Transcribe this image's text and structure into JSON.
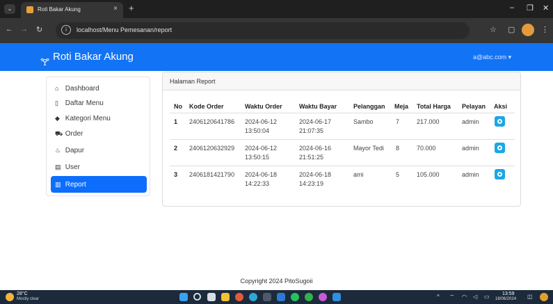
{
  "browser": {
    "tab_title": "Roti Bakar Akung",
    "tab_close": "×",
    "new_tab": "+",
    "url": "localhost/Menu Pemesanan/report",
    "win_min": "–",
    "win_max": "❐",
    "win_close": "✕"
  },
  "navbar": {
    "brand": "Roti Bakar Akung",
    "brand_icon": "🝖",
    "user_email": "a@abc.com ▾"
  },
  "sidebar": {
    "items": [
      {
        "label": "Dashboard",
        "icon": "home-icon",
        "glyph": "⌂"
      },
      {
        "label": "Daftar Menu",
        "icon": "book-icon",
        "glyph": "▯"
      },
      {
        "label": "Kategori Menu",
        "icon": "tag-icon",
        "glyph": "◆"
      },
      {
        "label": "Order",
        "icon": "cart-icon",
        "glyph": "⛟"
      },
      {
        "label": "Dapur",
        "icon": "fire-icon",
        "glyph": "♨"
      },
      {
        "label": "User",
        "icon": "user-card-icon",
        "glyph": "▤"
      },
      {
        "label": "Report",
        "icon": "chart-icon",
        "glyph": "▥"
      }
    ],
    "active": "Report"
  },
  "report": {
    "title": "Halaman Report",
    "columns": [
      "No",
      "Kode Order",
      "Waktu Order",
      "Waktu Bayar",
      "Pelanggan",
      "Meja",
      "Total Harga",
      "Pelayan",
      "Aksi"
    ],
    "rows": [
      {
        "no": "1",
        "kode": "2406120641786",
        "waktu_order_date": "2024-06-12",
        "waktu_order_time": "13:50:04",
        "waktu_bayar_date": "2024-06-17",
        "waktu_bayar_time": "21:07:35",
        "pelanggan": "Sambo",
        "meja": "7",
        "total": "217.000",
        "pelayan": "admin"
      },
      {
        "no": "2",
        "kode": "2406120632929",
        "waktu_order_date": "2024-06-12",
        "waktu_order_time": "13:50:15",
        "waktu_bayar_date": "2024-06-16",
        "waktu_bayar_time": "21:51:25",
        "pelanggan": "Mayor Tedi",
        "meja": "8",
        "total": "70.000",
        "pelayan": "admin"
      },
      {
        "no": "3",
        "kode": "2406181421790",
        "waktu_order_date": "2024-06-18",
        "waktu_order_time": "14:22:33",
        "waktu_bayar_date": "2024-06-18",
        "waktu_bayar_time": "14:23:19",
        "pelanggan": "ami",
        "meja": "5",
        "total": "105.000",
        "pelayan": "admin"
      }
    ]
  },
  "footer": {
    "text": "Copyright 2024 PitoSugoii"
  },
  "taskbar": {
    "temperature": "28°C",
    "weather": "Mostly clear",
    "time": "13:59",
    "date": "18/06/2024"
  },
  "colors": {
    "navbar": "#1273f5",
    "active_item": "#0d6efd",
    "action_button": "#1aa7e6"
  }
}
